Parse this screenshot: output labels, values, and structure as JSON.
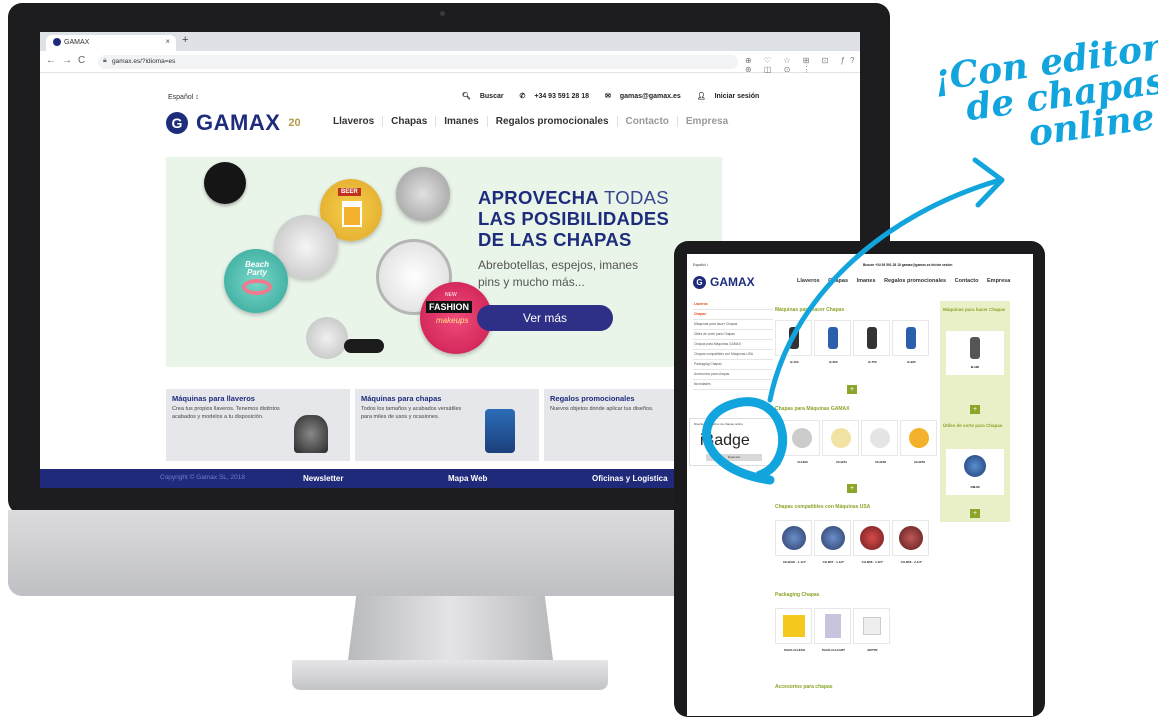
{
  "browser": {
    "tab_title": "GAMAX",
    "url": "gamax.es/?idioma=es",
    "nav_back": "←",
    "nav_forward": "→",
    "nav_reload": "C",
    "tab_close": "×",
    "tab_new": "+",
    "toolbar_icons": "⊕ ♡ ☆ ⊞ ⊡ ƒ? ⊛ ◫ ⊙ ⋮"
  },
  "site": {
    "language": "Español ↕",
    "top_menu": {
      "search": "Buscar",
      "phone": "+34 93 591 28 18",
      "email": "gamas@gamax.es",
      "login": "Iniciar sesión"
    },
    "logo_text": "GAMAX",
    "logo_anniversary": "20",
    "nav": [
      "Llaveros",
      "Chapas",
      "Imanes",
      "Regalos promocionales",
      "Contacto",
      "Empresa"
    ],
    "banner": {
      "title_bold_1": "APROVECHA",
      "title_light_1": " TODAS",
      "title_line_2": "LAS POSIBILIDADES",
      "title_line_3": "DE LAS CHAPAS",
      "subtitle_1": "Abrebotellas, espejos, imanes",
      "subtitle_2": "pins y mucho más...",
      "button": "Ver más",
      "badge_beer": "BEER",
      "badge_party": "Beach Party",
      "badge_fashion_top": "NEW",
      "badge_fashion": "FASHION",
      "badge_fashion_sub": "makeups"
    },
    "cards": [
      {
        "title": "Máquinas para llaveros",
        "text": "Crea tus propios llaveros. Tenemos distintos acabados y modelos a tu disposición."
      },
      {
        "title": "Máquinas para chapas",
        "text": "Todos los tamaños y acabados versátiles para miles de usos y ocasiones."
      },
      {
        "title": "Regalos promocionales",
        "text": "Nuevos objetos donde aplicar tus diseños."
      }
    ],
    "footer": {
      "copyright": "Copyright © Gamax SL, 2018",
      "newsletter": "Newsletter",
      "sitemap": "Mapa Web",
      "offices": "Oficinas y Logística"
    }
  },
  "tablet": {
    "language": "Español ↕",
    "top_menu": "Buscar  +34 93 591 28 18  gamas@gamax.es  Iniciar sesión",
    "nav": [
      "Llaveros",
      "Chapas",
      "Imanes",
      "Regalos promocionales",
      "Contacto",
      "Empresa"
    ],
    "sidebar": [
      "Llaveros",
      "Chapas",
      "Máquinas para hacer Chapas",
      "Útiles de corte para Chapas",
      "Chapas para Máquinas GAMAX",
      "Chapas compatibles con Máquinas USA",
      "Packaging Chapas",
      "Accesorios para chapas",
      "Novedades"
    ],
    "section_machines": "Máquinas para hacer Chapas",
    "machines": [
      "B-100",
      "B-600",
      "B-750",
      "B-905"
    ],
    "section_gamax": "Chapas para Máquinas GAMAX",
    "gamax_items": [
      "CH-900",
      "CH-B51",
      "CH-B58",
      "CH-B56"
    ],
    "section_usa": "Chapas compatibles con Máquinas USA",
    "usa_items": [
      "CH-BOG · 1-1/4\"",
      "CH-B57 · 1-1/2\"",
      "CH-B58 · 1-3/4\"",
      "CH-B56 · 2-1/4\""
    ],
    "section_packaging": "Packaging Chapas",
    "packaging_items": [
      "PACK-CH-EXH",
      "PACK-CH-CART",
      "BFPTB"
    ],
    "section_accessories": "Accesorios para chapas",
    "right_title_1": "Máquinas para hacer Chapas",
    "right_title_2": "Útiles de corte para Chapas",
    "right_item_1": "B-100",
    "right_item_2": "CM-90",
    "ibadge_small": "Diseña tus diseños de chapas online",
    "ibadge_logo": "iBadge",
    "ibadge_button": "Empezar"
  },
  "callout": {
    "line1": "¡Con editor",
    "line2": "de chapas",
    "line3": "online!"
  },
  "colors": {
    "brand_navy": "#1e2c7c",
    "accent_cyan": "#12a4dc",
    "green": "#8aa52a",
    "banner_bg": "#eaf5e9"
  }
}
